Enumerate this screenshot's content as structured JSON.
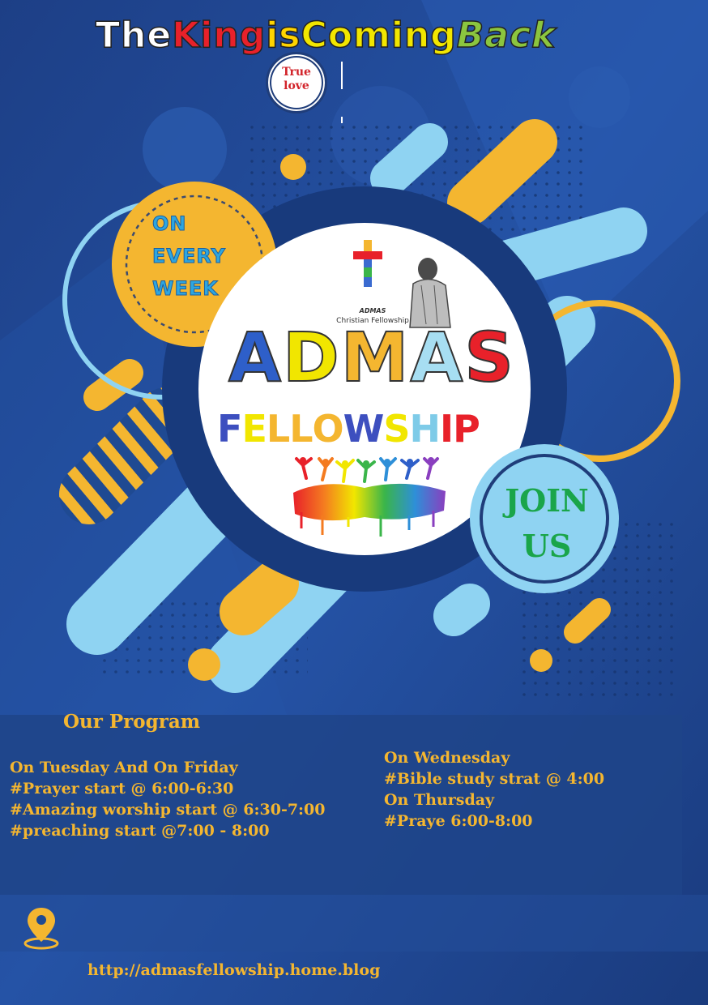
{
  "header": {
    "headline": [
      {
        "text": "The ",
        "color": "#ffffff"
      },
      {
        "text": "King",
        "color": "#e8212a"
      },
      {
        "text": " is ",
        "color": "#ffd400"
      },
      {
        "text": "Coming",
        "color": "#f2e600"
      },
      {
        "text": " Back",
        "color": "#8bc53f"
      }
    ],
    "seal_text": "True\nlove"
  },
  "badge": {
    "text": "ON\nEVERY\nWEEK"
  },
  "logo": {
    "org": "ADMAS",
    "caption": "Christian Fellowship"
  },
  "title": {
    "admas": [
      {
        "ch": "A",
        "color": "#2e5fc9"
      },
      {
        "ch": "D",
        "color": "#f1e600"
      },
      {
        "ch": "M",
        "color": "#f4b630"
      },
      {
        "ch": "A",
        "color": "#a7def2"
      },
      {
        "ch": "S",
        "color": "#e8212a"
      }
    ],
    "fellowship": [
      {
        "ch": "F",
        "color": "#3d4fbf"
      },
      {
        "ch": "E",
        "color": "#f1e600"
      },
      {
        "ch": "L",
        "color": "#f4b630"
      },
      {
        "ch": "L",
        "color": "#f4b630"
      },
      {
        "ch": "O",
        "color": "#f4b630"
      },
      {
        "ch": "W",
        "color": "#3d4fbf"
      },
      {
        "ch": "S",
        "color": "#f1e600"
      },
      {
        "ch": "H",
        "color": "#7ecbe8"
      },
      {
        "ch": "I",
        "color": "#e8212a"
      },
      {
        "ch": "P",
        "color": "#e8212a"
      }
    ]
  },
  "join": {
    "text": "JOIN\nUS"
  },
  "program": {
    "title": "Our Program",
    "left": [
      "On Tuesday  And On Friday",
      "#Prayer start @ 6:00-6:30",
      "#Amazing worship start @ 6:30-7:00",
      "#preaching start @7:00 - 8:00"
    ],
    "right": [
      "On Wednesday",
      "#Bible study strat @ 4:00",
      "On Thursday",
      "#Praye 6:00-8:00"
    ]
  },
  "footer": {
    "url": "http://admasfellowship.home.blog"
  },
  "icons": {
    "location": "location-pin-icon",
    "cross": "cross-icon"
  },
  "colors": {
    "background": "#1f4a92",
    "accent_yellow": "#f4b630",
    "accent_blue": "#8fd3f2"
  }
}
